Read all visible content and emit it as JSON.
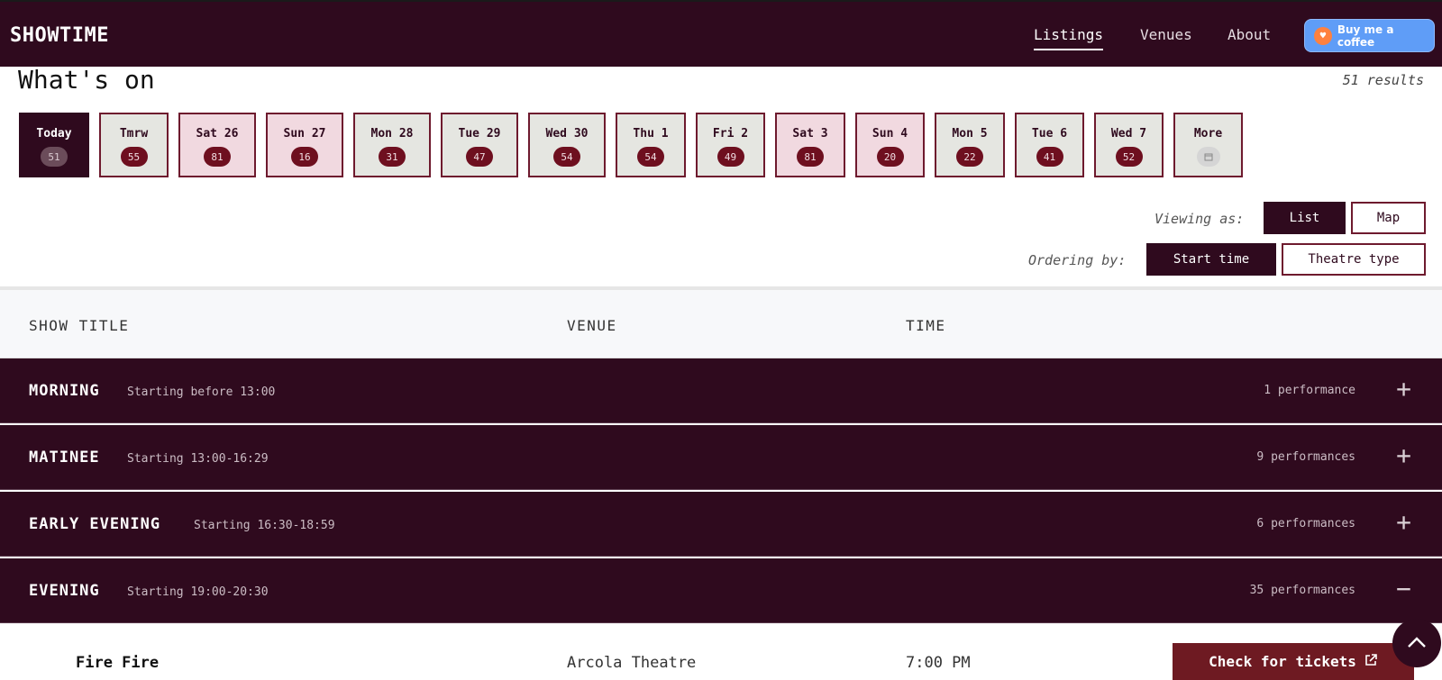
{
  "header": {
    "brand": "SHOWTIME",
    "nav": [
      "Listings",
      "Venues",
      "About"
    ],
    "coffee_label": "Buy me a coffee",
    "coffee_icon": "coffee-heart-icon"
  },
  "main": {
    "title": "What's on",
    "results": "51 results",
    "dates": [
      {
        "label": "Today",
        "count": "51",
        "kind": "selected"
      },
      {
        "label": "Tmrw",
        "count": "55",
        "kind": "weekday"
      },
      {
        "label": "Sat 26",
        "count": "81",
        "kind": "weekend"
      },
      {
        "label": "Sun 27",
        "count": "16",
        "kind": "weekend"
      },
      {
        "label": "Mon 28",
        "count": "31",
        "kind": "weekday"
      },
      {
        "label": "Tue 29",
        "count": "47",
        "kind": "weekday"
      },
      {
        "label": "Wed 30",
        "count": "54",
        "kind": "weekday"
      },
      {
        "label": "Thu 1",
        "count": "54",
        "kind": "weekday"
      },
      {
        "label": "Fri 2",
        "count": "49",
        "kind": "weekday"
      },
      {
        "label": "Sat 3",
        "count": "81",
        "kind": "weekend"
      },
      {
        "label": "Sun 4",
        "count": "20",
        "kind": "weekend"
      },
      {
        "label": "Mon 5",
        "count": "22",
        "kind": "weekday"
      },
      {
        "label": "Tue 6",
        "count": "41",
        "kind": "weekday"
      },
      {
        "label": "Wed 7",
        "count": "52",
        "kind": "weekday"
      },
      {
        "label": "More",
        "count": "",
        "kind": "weekday",
        "icon": "calendar-icon"
      }
    ],
    "viewing": {
      "label": "Viewing as:",
      "options": [
        "List",
        "Map"
      ],
      "selected": "List"
    },
    "ordering": {
      "label": "Ordering by:",
      "options": [
        "Start time",
        "Theatre type"
      ],
      "selected": "Start time"
    }
  },
  "table": {
    "columns": [
      "SHOW TITLE",
      "VENUE",
      "TIME"
    ],
    "groups": [
      {
        "name": "MORNING",
        "sub": "Starting before 13:00",
        "count": "1 performance",
        "toggle": "+"
      },
      {
        "name": "MATINEE",
        "sub": "Starting 13:00-16:29",
        "count": "9 performances",
        "toggle": "+"
      },
      {
        "name": "EARLY EVENING",
        "sub": "Starting 16:30-18:59",
        "count": "6 performances",
        "toggle": "+"
      },
      {
        "name": "EVENING",
        "sub": "Starting 19:00-20:30",
        "count": "35 performances",
        "toggle": "−"
      }
    ],
    "rows": [
      {
        "title": "Fire Fire",
        "venue": "Arcola Theatre",
        "time": "7:00 PM",
        "action": "Check for tickets"
      }
    ]
  },
  "colors": {
    "brand": "#2f0a1e",
    "accent": "#6e1a22",
    "weekend": "#f1d9e0",
    "weekday": "#e5e6e1"
  }
}
